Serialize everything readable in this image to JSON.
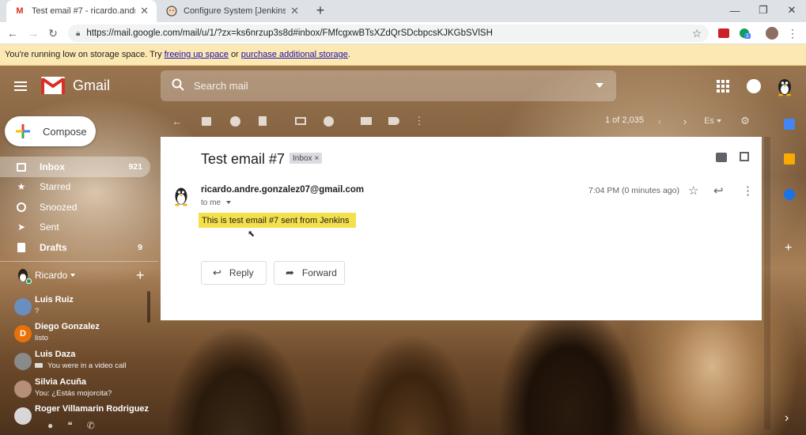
{
  "browser": {
    "tabs": [
      {
        "title": "Test email #7 - ricardo.andre.gon",
        "active": true
      },
      {
        "title": "Configure System [Jenkins]",
        "active": false
      }
    ],
    "new_tab_symbol": "+",
    "url": "https://mail.google.com/mail/u/1/?zx=ks6nrzup3s8d#inbox/FMfcgxwBTsXZdQrSDcbpcsKJKGbSVlSH",
    "extension_badge": "1"
  },
  "banner": {
    "prefix": "You're running low on storage space. Try",
    "link1": "freeing up space",
    "middle": "or",
    "link2": "purchase additional storage",
    "suffix": "."
  },
  "header": {
    "brand": "Gmail",
    "search_placeholder": "Search mail"
  },
  "compose": {
    "label": "Compose"
  },
  "sidebar": {
    "items": [
      {
        "label": "Inbox",
        "count": "921",
        "icon": "inbox-icon"
      },
      {
        "label": "Starred",
        "count": "",
        "icon": "star-icon"
      },
      {
        "label": "Snoozed",
        "count": "",
        "icon": "clock-icon"
      },
      {
        "label": "Sent",
        "count": "",
        "icon": "send-icon"
      },
      {
        "label": "Drafts",
        "count": "9",
        "icon": "draft-icon"
      }
    ]
  },
  "hangouts": {
    "user": "Ricardo",
    "contacts": [
      {
        "name": "Luis Ruiz",
        "status": "?",
        "color": "#6a8fbf"
      },
      {
        "name": "Diego Gonzalez",
        "status": "listo",
        "color": "#e8710a",
        "initial": "D"
      },
      {
        "name": "Luis Daza",
        "status": "You were in a video call",
        "color": "#8a8a8a"
      },
      {
        "name": "Silvia Acuña",
        "status": "You: ¿Estás mojorcita?",
        "color": "#b58f7a"
      },
      {
        "name": "Roger Villamarin Rodriguez",
        "status": "",
        "color": "#d7d7d7"
      }
    ]
  },
  "toolbar": {
    "page_count": "1 of 2,035",
    "language": "Es"
  },
  "email": {
    "subject": "Test email #7",
    "label": "Inbox",
    "label_close": "×",
    "sender": "ricardo.andre.gonzalez07@gmail.com",
    "to": "to me",
    "time": "7:04 PM (0 minutes ago)",
    "body": "This is test email #7 sent from Jenkins",
    "reply_label": "Reply",
    "forward_label": "Forward"
  },
  "colors": {
    "highlight": "#f4e04b",
    "gmail_red": "#d93025",
    "banner": "#fce8b2"
  }
}
